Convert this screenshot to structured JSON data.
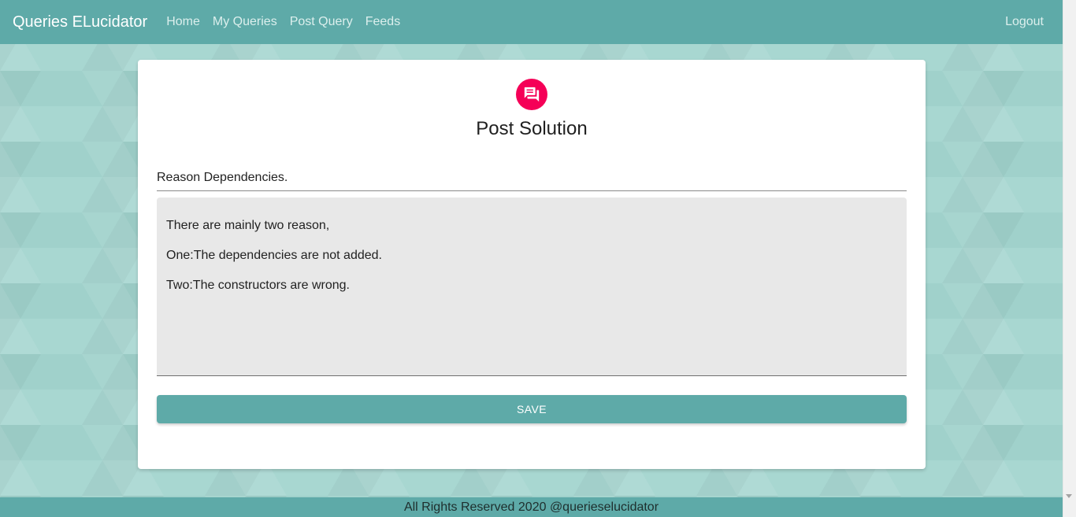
{
  "navbar": {
    "brand": "Queries ELucidator",
    "links": [
      "Home",
      "My Queries",
      "Post Query",
      "Feeds"
    ],
    "logout": "Logout"
  },
  "card": {
    "icon": "forum-icon",
    "title": "Post Solution",
    "query_title_value": "Reason Dependencies.",
    "solution_lines": [
      "There are mainly two reason,",
      "One:The dependencies are not added.",
      "Two:The constructors are wrong."
    ],
    "save_label": "SAVE"
  },
  "footer": {
    "text": "All Rights Reserved 2020 @querieselucidator"
  },
  "colors": {
    "primary": "#5eaaa8",
    "accent": "#f50057"
  }
}
